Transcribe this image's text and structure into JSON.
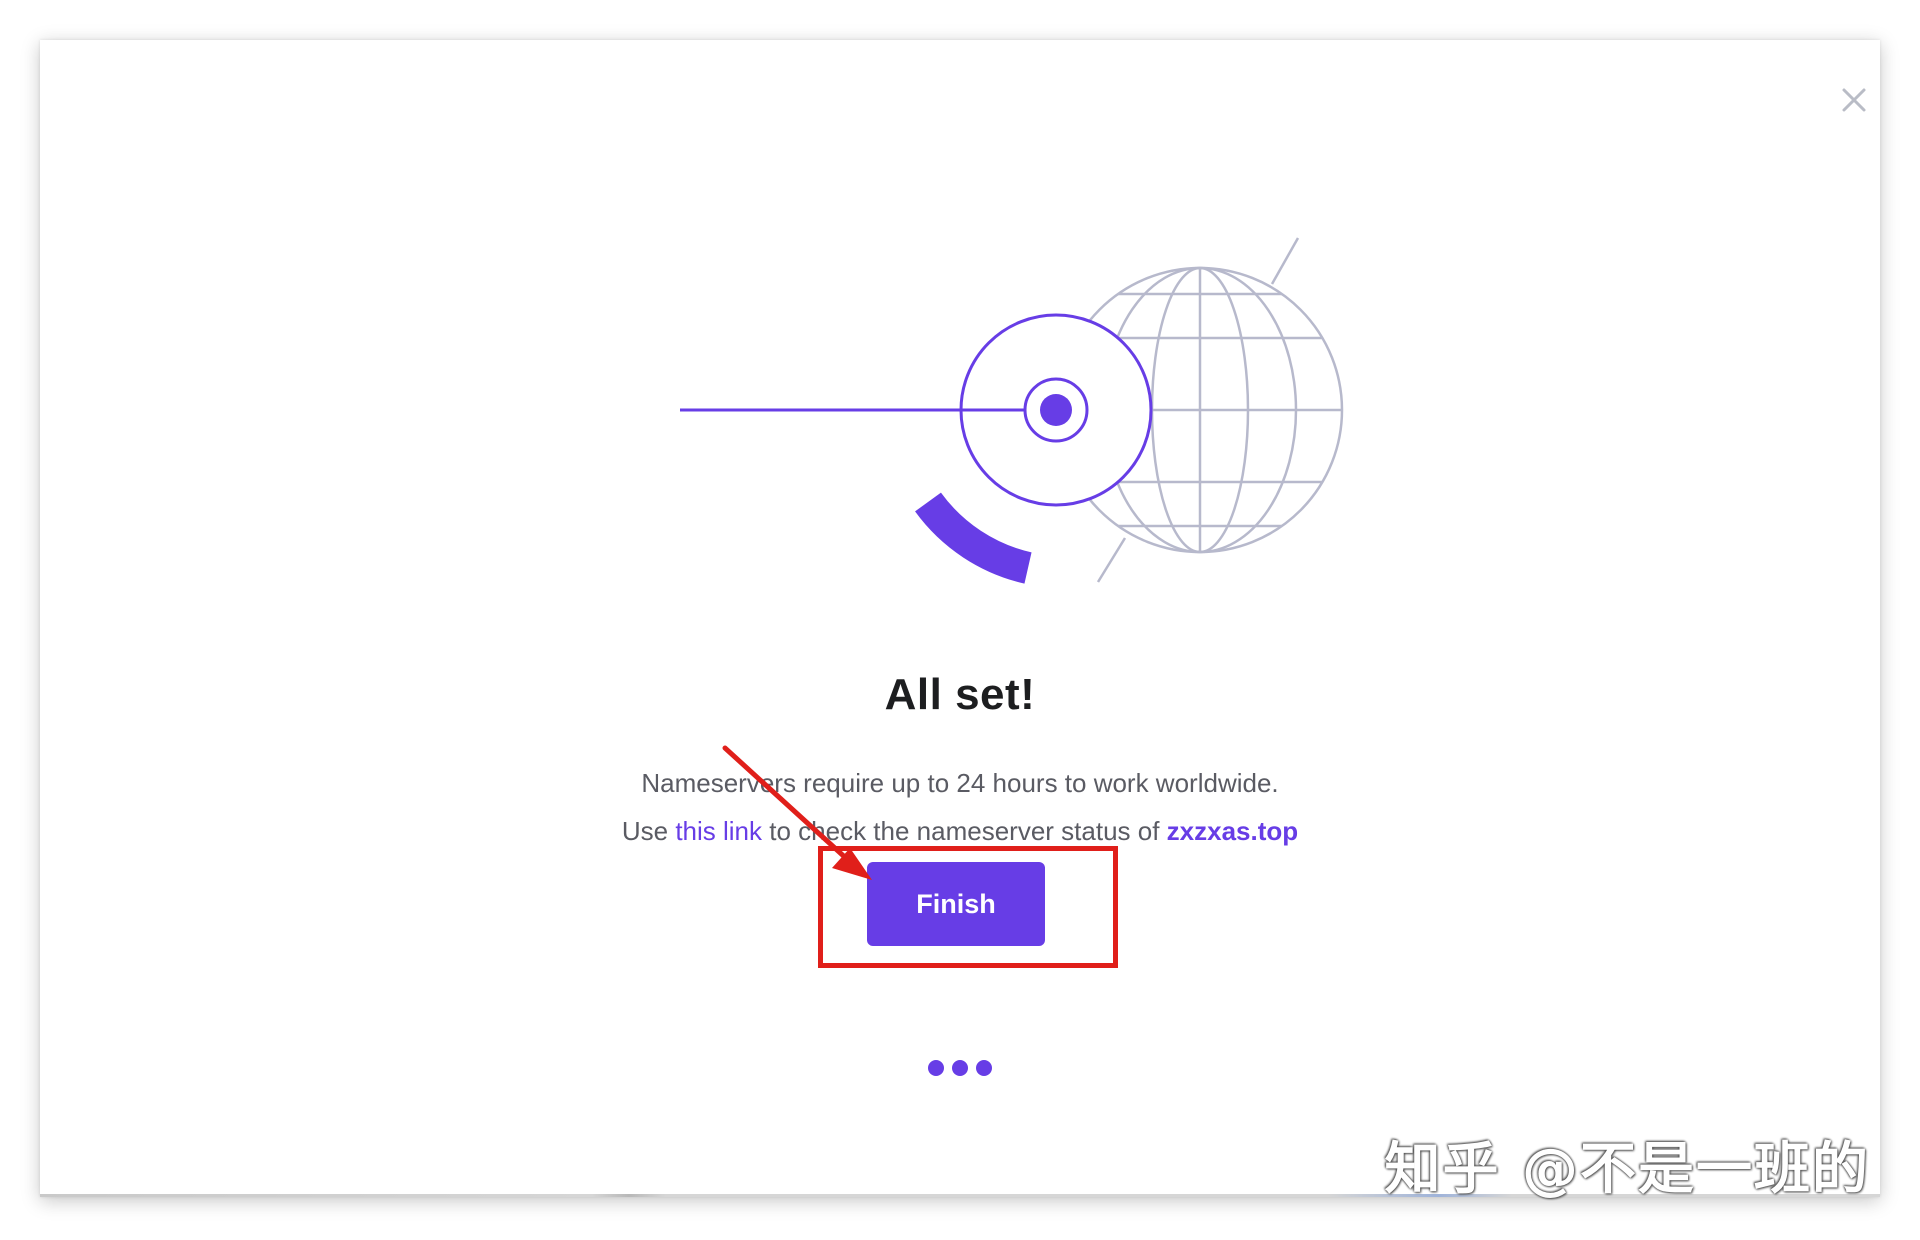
{
  "dialog": {
    "close_label": "×"
  },
  "content": {
    "title": "All set!",
    "line1": "Nameservers require up to 24 hours to work worldwide.",
    "line2_prefix": "Use ",
    "line2_link": "this link",
    "line2_middle": " to check the nameserver status of ",
    "line2_domain": "zxzxas.top"
  },
  "actions": {
    "finish_label": "Finish"
  },
  "progress": {
    "current_step": 3,
    "total_steps": 3
  },
  "watermark": {
    "text": "知乎 @不是一班的"
  },
  "colors": {
    "accent": "#673de6",
    "annotation": "#e01f1a",
    "globe_lines": "#b7b9cc",
    "title": "#1d1e20",
    "body_text": "#5a5b63"
  }
}
